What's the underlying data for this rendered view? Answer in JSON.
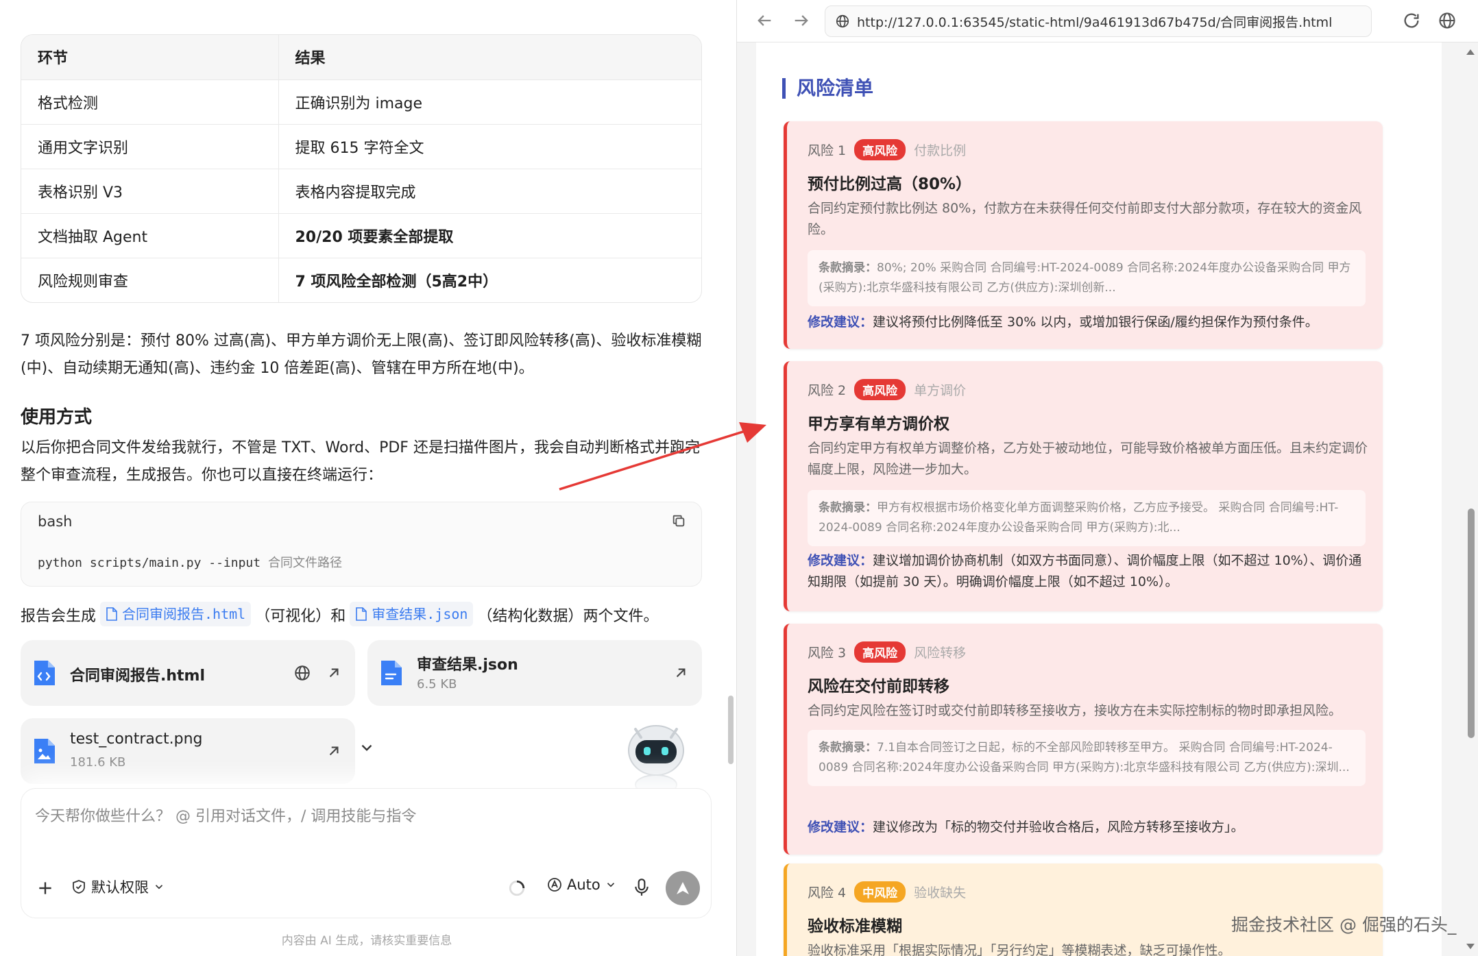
{
  "table": {
    "headers": [
      "环节",
      "结果"
    ],
    "rows": [
      {
        "step": "格式检测",
        "result": "正确识别为 image",
        "bold": false
      },
      {
        "step": "通用文字识别",
        "result": "提取 615 字符全文",
        "bold": false
      },
      {
        "step": "表格识别 V3",
        "result": "表格内容提取完成",
        "bold": false
      },
      {
        "step": "文档抽取 Agent",
        "result": "20/20 项要素全部提取",
        "bold": true
      },
      {
        "step": "风险规则审查",
        "result": "7 项风险全部检测（5高2中）",
        "bold": true
      }
    ]
  },
  "summary": "7 项风险分别是：预付 80% 过高(高)、甲方单方调价无上限(高)、签订即风险转移(高)、验收标准模糊(中)、自动续期无通知(高)、违约金 10 倍差距(高)、管辖在甲方所在地(中)。",
  "usage": {
    "title": "使用方式",
    "text": "以后你把合同文件发给我就行，不管是 TXT、Word、PDF 还是扫描件图片，我会自动判断格式并跑完整个审查流程，生成报告。你也可以直接在终端运行："
  },
  "code": {
    "lang": "bash",
    "command": "python scripts/main.py --input ",
    "placeholder": "合同文件路径"
  },
  "report_line": {
    "prefix": "报告会生成",
    "file1": "合同审阅报告.html",
    "mid1": "（可视化）和",
    "file2": "审查结果.json",
    "suffix": "（结构化数据）两个文件。"
  },
  "files": [
    {
      "name": "合同审阅报告.html",
      "size": ""
    },
    {
      "name": "审查结果.json",
      "size": "6.5 KB"
    },
    {
      "name": "test_contract.png",
      "size": "181.6 KB"
    }
  ],
  "composer": {
    "placeholder": "今天帮你做些什么？ @ 引用对话文件，/ 调用技能与指令",
    "permission": "默认权限",
    "mode": "Auto"
  },
  "disclaimer": "内容由 AI 生成，请核实重要信息",
  "browser": {
    "url": "http://127.0.0.1:63545/static-html/9a461913d67b475d/合同审阅报告.html"
  },
  "report": {
    "section_title": "风险清单",
    "risks": [
      {
        "num": "风险 1",
        "level": "高风险",
        "category": "付款比例",
        "title": "预付比例过高（80%）",
        "desc": "合同约定预付款比例达 80%，付款方在未获得任何交付前即支付大部分款项，存在较大的资金风险。",
        "excerpt_label": "条款摘录：",
        "excerpt": "80%; 20% 采购合同 合同编号:HT-2024-0089 合同名称:2024年度办公设备采购合同 甲方(采购方):北京华盛科技有限公司 乙方(供应方):深圳创新...",
        "suggest_label": "修改建议：",
        "suggest": "建议将预付比例降低至 30% 以内，或增加银行保函/履约担保作为预付条件。"
      },
      {
        "num": "风险 2",
        "level": "高风险",
        "category": "单方调价",
        "title": "甲方享有单方调价权",
        "desc": "合同约定甲方有权单方调整价格，乙方处于被动地位，可能导致价格被单方面压低。且未约定调价幅度上限，风险进一步加大。",
        "excerpt_label": "条款摘录：",
        "excerpt": "甲方有权根据市场价格变化单方面调整采购价格，乙方应予接受。 采购合同 合同编号:HT-2024-0089 合同名称:2024年度办公设备采购合同 甲方(采购方):北...",
        "suggest_label": "修改建议：",
        "suggest": "建议增加调价协商机制（如双方书面同意）、调价幅度上限（如不超过 10%）、调价通知期限（如提前 30 天）。明确调价幅度上限（如不超过 10%）。"
      },
      {
        "num": "风险 3",
        "level": "高风险",
        "category": "风险转移",
        "title": "风险在交付前即转移",
        "desc": "合同约定风险在签订时或交付前即转移至接收方，接收方在未实际控制标的物时即承担风险。",
        "excerpt_label": "条款摘录：",
        "excerpt": "7.1自本合同签订之日起，标的不全部风险即转移至甲方。 采购合同 合同编号:HT-2024-0089 合同名称:2024年度办公设备采购合同 甲方(采购方):北京华盛科技有限公司 乙方(供应方):深圳...",
        "suggest_label": "修改建议：",
        "suggest": "建议修改为「标的物交付并验收合格后，风险方转移至接收方」。"
      },
      {
        "num": "风险 4",
        "level": "中风险",
        "category": "验收缺失",
        "title": "验收标准模糊",
        "desc": "验收标准采用「根据实际情况」「另行约定」等模糊表述，缺乏可操作性。",
        "excerpt_label": "",
        "excerpt": "",
        "suggest_label": "",
        "suggest": ""
      }
    ]
  },
  "watermark": "掘金技术社区 @ 倔强的石头_"
}
